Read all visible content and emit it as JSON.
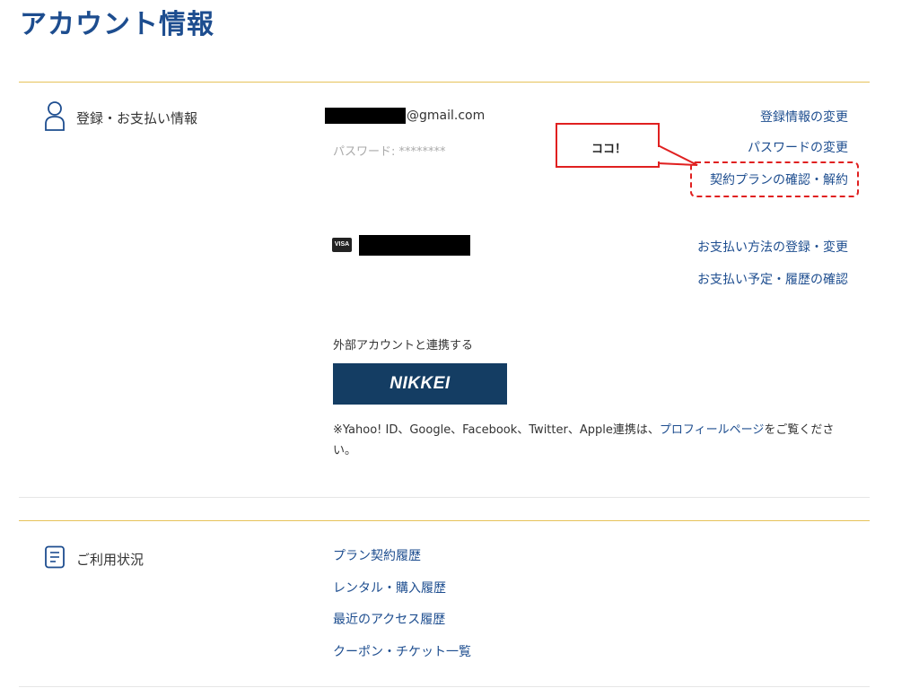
{
  "page": {
    "title": "アカウント情報"
  },
  "account_section": {
    "title": "登録・お支払い情報",
    "email_suffix": "@gmail.com",
    "password": "パスワード: ********",
    "links": {
      "edit_registration": "登録情報の変更",
      "change_password": "パスワードの変更",
      "plan_cancel": "契約プランの確認・解約",
      "payment_method": "お支払い方法の登録・変更",
      "payment_history": "お支払い予定・履歴の確認"
    },
    "callout_text": "ココ！",
    "card_brand": "VISA",
    "external": {
      "title": "外部アカウントと連携する",
      "nikkei_label": "NIKKEI",
      "note_prefix": "※Yahoo! ID、Google、Facebook、Twitter、Apple連携は、",
      "note_link": "プロフィールページ",
      "note_suffix": "をご覧ください。"
    }
  },
  "usage_section": {
    "title": "ご利用状況",
    "items": [
      "プラン契約履歴",
      "レンタル・購入履歴",
      "最近のアクセス履歴",
      "クーポン・チケット一覧"
    ]
  },
  "colors": {
    "brand_blue": "#1d4d8f",
    "nikkei_navy": "#143d63",
    "accent_gold": "#e6c25a",
    "highlight_red": "#e02020"
  }
}
